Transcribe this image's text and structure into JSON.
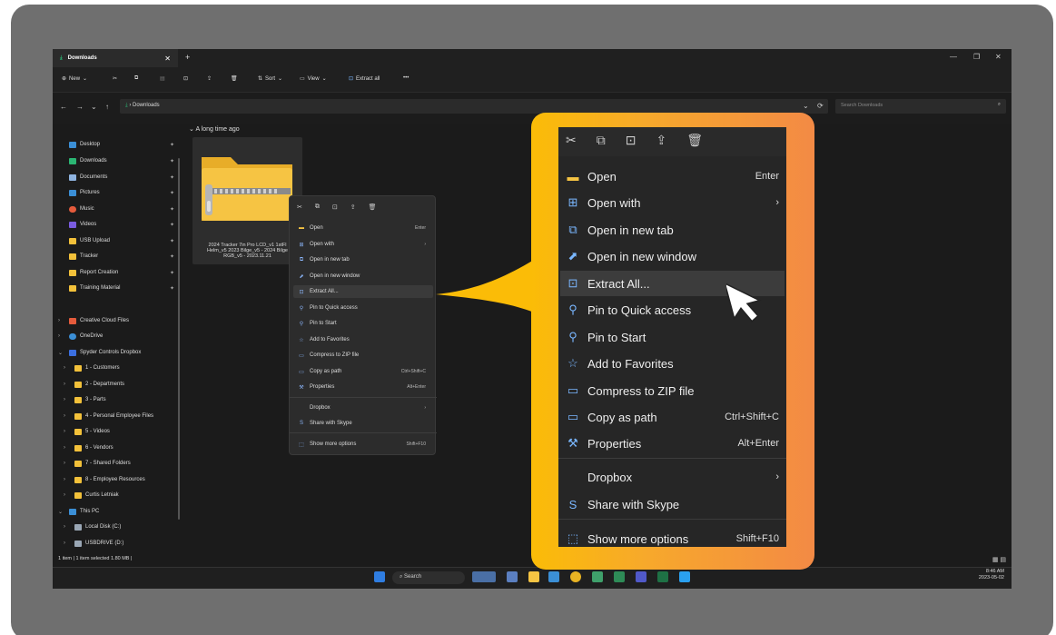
{
  "window": {
    "tab_title": "Downloads",
    "tab_close": "✕",
    "new_tab": "+",
    "minimize": "—",
    "maximize": "❐",
    "close": "✕"
  },
  "toolbar": {
    "new_label": "New",
    "sort_label": "Sort",
    "view_label": "View",
    "extract_all_label": "Extract all",
    "more_label": "•••"
  },
  "address": {
    "back": "←",
    "forward": "→",
    "recent": "⌄",
    "up": "↑",
    "path": "Downloads",
    "refresh": "⟳",
    "search_placeholder": "Search Downloads"
  },
  "sidebar": {
    "quick_access": [
      {
        "label": "Desktop",
        "color": "#3b8fd6"
      },
      {
        "label": "Downloads",
        "color": "#2bb673"
      },
      {
        "label": "Documents",
        "color": "#8fb4e0"
      },
      {
        "label": "Pictures",
        "color": "#3b8fd6"
      },
      {
        "label": "Music",
        "color": "#e55b3c"
      },
      {
        "label": "Videos",
        "color": "#7a5ce0"
      },
      {
        "label": "USB Upload",
        "color": "#f3c13a"
      },
      {
        "label": "Tracker",
        "color": "#f3c13a"
      },
      {
        "label": "Report Creation",
        "color": "#f3c13a"
      },
      {
        "label": "Training Material",
        "color": "#f3c13a"
      }
    ],
    "tree": [
      {
        "label": "Creative Cloud Files",
        "color": "#e55b3c",
        "indent": 0,
        "chev": ">"
      },
      {
        "label": "OneDrive",
        "color": "#3b8fd6",
        "indent": 0,
        "chev": ">"
      },
      {
        "label": "Spyder Controls Dropbox",
        "color": "#3b6fe0",
        "indent": 0,
        "chev": "⌄"
      },
      {
        "label": "1 - Customers",
        "color": "#f3c13a",
        "indent": 1,
        "chev": ">"
      },
      {
        "label": "2 - Departments",
        "color": "#f3c13a",
        "indent": 1,
        "chev": ">"
      },
      {
        "label": "3 - Parts",
        "color": "#f3c13a",
        "indent": 1,
        "chev": ">"
      },
      {
        "label": "4 - Personal Employee Files",
        "color": "#f3c13a",
        "indent": 1,
        "chev": ">"
      },
      {
        "label": "5 - Videos",
        "color": "#f3c13a",
        "indent": 1,
        "chev": ">"
      },
      {
        "label": "6 - Vendors",
        "color": "#f3c13a",
        "indent": 1,
        "chev": ">"
      },
      {
        "label": "7 - Shared Folders",
        "color": "#f3c13a",
        "indent": 1,
        "chev": ">"
      },
      {
        "label": "8 - Employee Resources",
        "color": "#f3c13a",
        "indent": 1,
        "chev": ">"
      },
      {
        "label": "Curtis Letniak",
        "color": "#f3c13a",
        "indent": 1,
        "chev": ">"
      },
      {
        "label": "This PC",
        "color": "#3b8fd6",
        "indent": 0,
        "chev": "⌄"
      },
      {
        "label": "Local Disk (C:)",
        "color": "#9aa7b5",
        "indent": 1,
        "chev": ">"
      },
      {
        "label": "USBDRIVE (D:)",
        "color": "#9aa7b5",
        "indent": 1,
        "chev": ">"
      }
    ]
  },
  "content": {
    "group_label": "A long time ago",
    "file_name_line1": "2024 Tracker 7in Pro LCD_v1 1stFl",
    "file_name_line2": "Helm_v5 2023 Bilge_v5 - 2024 Bilge",
    "file_name_line3": "RGB_v5 - 2023.11.21"
  },
  "context_menu_small": {
    "items": [
      {
        "label": "Open",
        "accel": "Enter",
        "icon": "▬"
      },
      {
        "label": "Open with",
        "accel": "›",
        "icon": "⊞"
      },
      {
        "label": "Open in new tab",
        "accel": "",
        "icon": "⧉"
      },
      {
        "label": "Open in new window",
        "accel": "",
        "icon": "⬈"
      },
      {
        "label": "Extract All...",
        "accel": "",
        "icon": "⊡"
      },
      {
        "label": "Pin to Quick access",
        "accel": "",
        "icon": "⚲"
      },
      {
        "label": "Pin to Start",
        "accel": "",
        "icon": "⚲"
      },
      {
        "label": "Add to Favorites",
        "accel": "",
        "icon": "☆"
      },
      {
        "label": "Compress to ZIP file",
        "accel": "",
        "icon": "▭"
      },
      {
        "label": "Copy as path",
        "accel": "Ctrl+Shift+C",
        "icon": "▭"
      },
      {
        "label": "Properties",
        "accel": "Alt+Enter",
        "icon": "⚒"
      },
      {
        "label": "Dropbox",
        "accel": "›",
        "icon": ""
      },
      {
        "label": "Share with Skype",
        "accel": "",
        "icon": "S"
      },
      {
        "label": "Show more options",
        "accel": "Shift+F10",
        "icon": "⬚"
      }
    ]
  },
  "context_menu_big": {
    "items": [
      {
        "label": "Open",
        "accel": "Enter",
        "icon": "▬"
      },
      {
        "label": "Open with",
        "accel": "›",
        "icon": "⊞"
      },
      {
        "label": "Open in new tab",
        "accel": "",
        "icon": "⧉"
      },
      {
        "label": "Open in new window",
        "accel": "",
        "icon": "⬈"
      },
      {
        "label": "Extract All...",
        "accel": "",
        "icon": "⊡"
      },
      {
        "label": "Pin to Quick access",
        "accel": "",
        "icon": "⚲"
      },
      {
        "label": "Pin to Start",
        "accel": "",
        "icon": "⚲"
      },
      {
        "label": "Add to Favorites",
        "accel": "",
        "icon": "☆"
      },
      {
        "label": "Compress to ZIP file",
        "accel": "",
        "icon": "▭"
      },
      {
        "label": "Copy as path",
        "accel": "Ctrl+Shift+C",
        "icon": "▭"
      },
      {
        "label": "Properties",
        "accel": "Alt+Enter",
        "icon": "⚒"
      },
      {
        "label": "Dropbox",
        "accel": "›",
        "icon": ""
      },
      {
        "label": "Share with Skype",
        "accel": "",
        "icon": "S"
      },
      {
        "label": "Show more options",
        "accel": "Shift+F10",
        "icon": "⬚"
      }
    ]
  },
  "statusbar": {
    "text": "1 item  |  1 item selected  1.80 MB  |"
  },
  "taskbar": {
    "search_label": "Search",
    "time": "8:46 AM",
    "date": "2023-05-02"
  },
  "colors": {
    "callout_start": "#fbbc07",
    "callout_end": "#f38a45",
    "folder": "#f6c443",
    "accent_blue": "#7ab7ff"
  }
}
